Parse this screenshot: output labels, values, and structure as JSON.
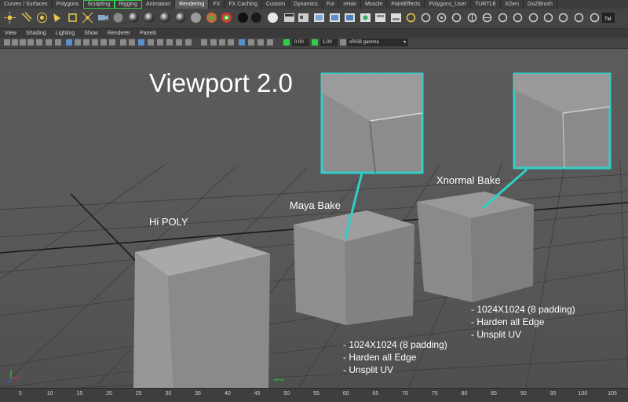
{
  "shelf_tabs": [
    {
      "label": "Curves / Surfaces"
    },
    {
      "label": "Polygons"
    },
    {
      "label": "Sculpting"
    },
    {
      "label": "Rigging"
    },
    {
      "label": "Animation"
    },
    {
      "label": "Rendering"
    },
    {
      "label": "FX"
    },
    {
      "label": "FX Caching"
    },
    {
      "label": "Custom"
    },
    {
      "label": "Dynamics"
    },
    {
      "label": "Fur"
    },
    {
      "label": "nHair"
    },
    {
      "label": "Muscle"
    },
    {
      "label": "PaintEffects"
    },
    {
      "label": "Polygons_User"
    },
    {
      "label": "TURTLE"
    },
    {
      "label": "XGen"
    },
    {
      "label": "GoZBrush"
    }
  ],
  "active_tab": "Rendering",
  "panel_menu": [
    "View",
    "Shading",
    "Lighting",
    "Show",
    "Renderer",
    "Panels"
  ],
  "toolbar": {
    "exposure": "0.00",
    "gamma": "1.00",
    "color_space": "sRGB gamma"
  },
  "viewport": {
    "title": "Viewport 2.0",
    "labels": {
      "hi_poly": "Hi POLY",
      "maya_bake": "Maya Bake",
      "xnormal_bake": "Xnormal Bake"
    },
    "notes_maya": [
      "- 1024X1024 (8 padding)",
      "- Harden all Edge",
      "- Unsplit UV"
    ],
    "notes_xnormal": [
      "- 1024X1024 (8 padding)",
      "- Harden all Edge",
      "- Unsplit UV"
    ],
    "camera": "persp",
    "highlight_color": "#2fd0c8"
  },
  "time_slider": {
    "ticks": [
      "5",
      "10",
      "15",
      "20",
      "25",
      "30",
      "35",
      "40",
      "45",
      "50",
      "55",
      "60",
      "65",
      "70",
      "75",
      "80",
      "85",
      "90",
      "95",
      "100",
      "105"
    ]
  }
}
